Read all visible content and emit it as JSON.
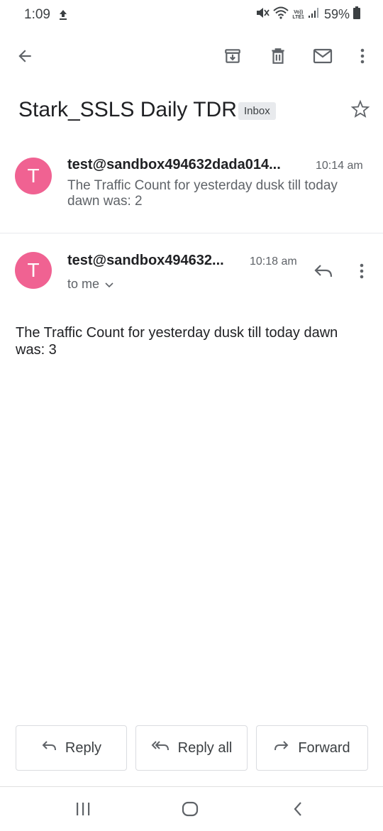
{
  "status": {
    "time": "1:09",
    "upload_icon": "upload-arrow-icon",
    "battery": "59%",
    "network": [
      "Vo))",
      "LTE1"
    ]
  },
  "toolbar": {
    "back_icon": "arrow-back-icon",
    "archive_icon": "archive-icon",
    "delete_icon": "trash-icon",
    "mark_unread_icon": "mail-icon",
    "more_icon": "more-vert-icon"
  },
  "thread": {
    "subject": "Stark_SSLS Daily TDR",
    "label": "Inbox",
    "messages": [
      {
        "avatar": "T",
        "sender": "test@sandbox494632dada014...",
        "time": "10:14 am",
        "snippet": "The Traffic Count for yesterday dusk till today dawn was: 2"
      },
      {
        "avatar": "T",
        "sender": "test@sandbox494632...",
        "time": "10:18 am",
        "recipient": "to me",
        "body": "The Traffic Count for yesterday dusk till today dawn was: 3"
      }
    ]
  },
  "actions": {
    "reply": "Reply",
    "reply_all": "Reply all",
    "forward": "Forward"
  },
  "colors": {
    "avatar": "#f06292",
    "chip_bg": "#e8eaed",
    "muted_text": "#5f6368"
  }
}
